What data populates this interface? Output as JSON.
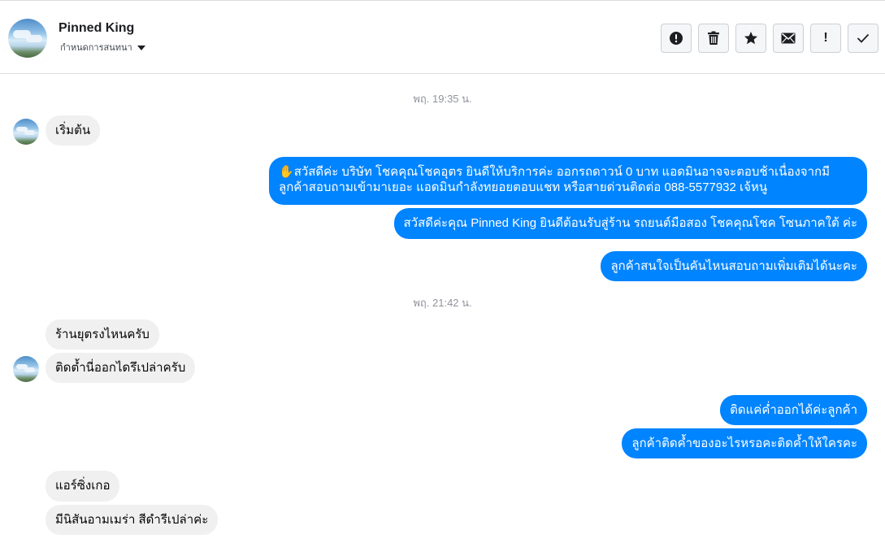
{
  "header": {
    "contact_name": "Pinned King",
    "assign_label": "กำหนดการสนทนา",
    "toolbar": [
      {
        "icon": "alert-circle-icon"
      },
      {
        "icon": "trash-icon"
      },
      {
        "icon": "star-icon"
      },
      {
        "icon": "envelope-icon"
      },
      {
        "icon": "exclamation-icon",
        "label": "!"
      },
      {
        "icon": "checkmark-icon"
      }
    ]
  },
  "conversation": {
    "timestamps": [
      "พฤ. 19:35 น.",
      "พฤ. 21:42 น."
    ],
    "messages": [
      {
        "from": "customer",
        "text": "เริ่มต้น"
      },
      {
        "from": "page",
        "emoji": "✋",
        "lines": [
          "สวัสดีค่ะ บริษัท โชคคุณโชคอุตร ยินดีให้บริการค่ะ ออกรถดาวน์ 0 บาท แอดมินอาจจะตอบช้าเนื่องจากมี",
          "ลูกค้าสอบถามเข้ามาเยอะ แอดมินกำลังทยอยตอบแชท หรือสายด่วนติดต่อ 088-5577932 เจ้หนู"
        ]
      },
      {
        "from": "page",
        "text": "สวัสดีค่ะคุณ Pinned King ยินดีต้อนรับสู่ร้าน รถยนต์มือสอง โชคคุณโชค โซนภาคใต้ ค่ะ"
      },
      {
        "from": "page",
        "text": "ลูกค้าสนใจเป็นคันไหนสอบถามเพิ่มเติมได้นะคะ"
      },
      {
        "from": "customer",
        "text": "ร้านยุตรงไหนครับ"
      },
      {
        "from": "customer",
        "text": "ติดต้ำนี่ออกไดรึเปล่าครับ"
      },
      {
        "from": "page",
        "text": "ติดแค่ค่ำออกได้ค่ะลูกค้า"
      },
      {
        "from": "page",
        "text": "ลูกค้าติดค้ำของอะไรหรอคะติดค้ำให้ใครคะ"
      },
      {
        "from": "customer",
        "text": "แอร์ซิ่งเกอ"
      },
      {
        "from": "customer",
        "text": "มีนิสันอามเมร่า สีดำรีเปล่าค่ะ"
      }
    ]
  },
  "colors": {
    "outgoing_bubble": "#0084ff",
    "incoming_bubble": "#f0f0f0",
    "timestamp": "#90949c"
  }
}
